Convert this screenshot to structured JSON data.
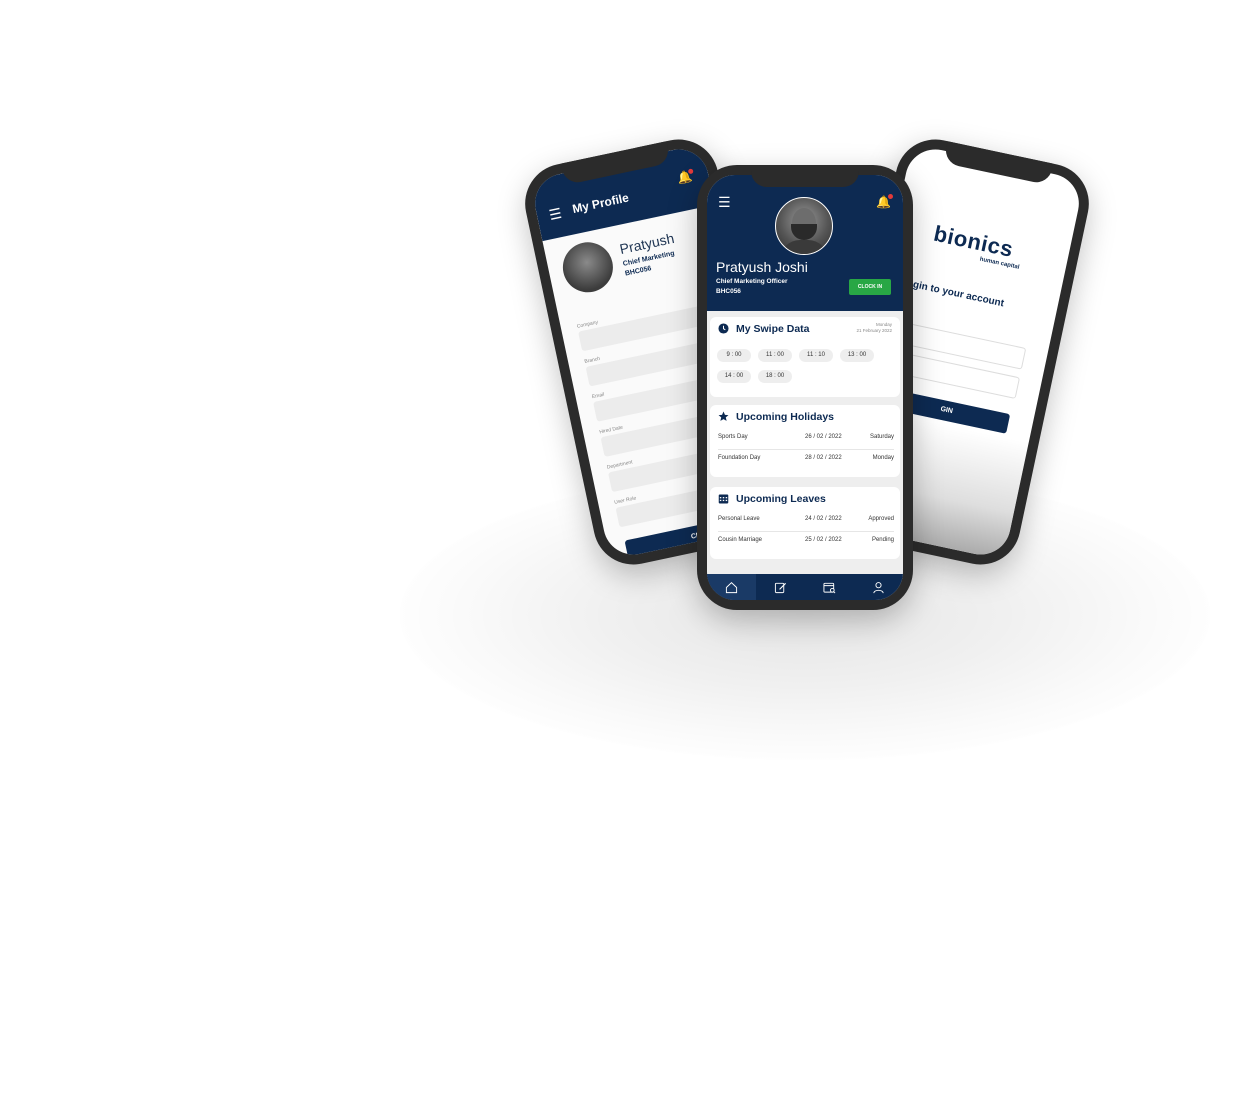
{
  "left_phone": {
    "title": "My Profile",
    "name": "Pratyush",
    "role": "Chief Marketing",
    "employee_id": "BHC056",
    "fields": [
      "Company",
      "Branch",
      "Email",
      "Hired Date",
      "Department",
      "User Role"
    ],
    "button_label": "CHAN"
  },
  "right_phone": {
    "logo": "bionics",
    "logo_sub": "human capital",
    "heading": "gin to your account",
    "login_label": "GIN"
  },
  "center_phone": {
    "profile": {
      "name": "Pratyush Joshi",
      "role": "Chief Marketing Officer",
      "employee_id": "BHC056",
      "clock_in_label": "CLOCK IN"
    },
    "swipe": {
      "title": "My Swipe Data",
      "day": "Monday",
      "date": "21 February 2022",
      "times": [
        "9 : 00",
        "11 : 00",
        "11 : 10",
        "13 : 00",
        "14 : 00",
        "18 : 00"
      ]
    },
    "holidays": {
      "title": "Upcoming Holidays",
      "rows": [
        {
          "name": "Sports Day",
          "date": "26 / 02 / 2022",
          "day": "Saturday"
        },
        {
          "name": "Foundation Day",
          "date": "28 / 02 / 2022",
          "day": "Monday"
        }
      ]
    },
    "leaves": {
      "title": "Upcoming Leaves",
      "rows": [
        {
          "name": "Personal Leave",
          "date": "24 / 02 / 2022",
          "status": "Approved"
        },
        {
          "name": "Cousin Marriage",
          "date": "25 / 02 / 2022",
          "status": "Pending"
        }
      ]
    },
    "bottom_nav": [
      "home-icon",
      "edit-icon",
      "calendar-search-icon",
      "user-icon"
    ]
  },
  "colors": {
    "navy": "#0d2a52",
    "clock_in_green": "#28a745",
    "notification_red": "#e23a3a"
  }
}
